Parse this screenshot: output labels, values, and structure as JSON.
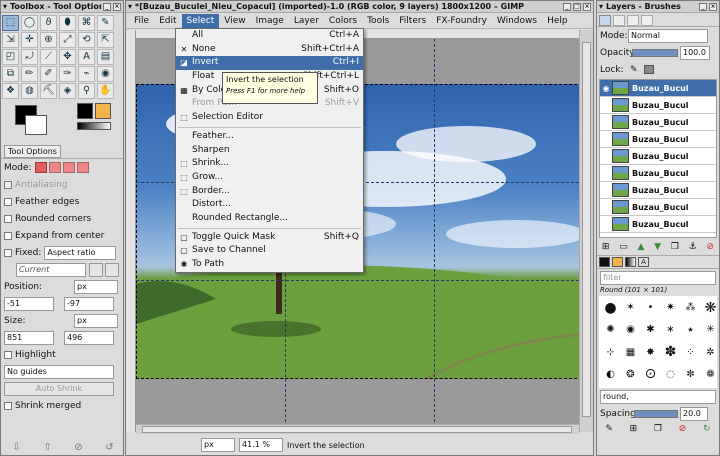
{
  "toolbox": {
    "title": "Toolbox - Tool Options",
    "tool_icons": [
      "⬚",
      "◯",
      "ϑ",
      "⬮",
      "⌘",
      "✎",
      "⇲",
      "✛",
      "⊕",
      "⤢",
      "⟲",
      "⇱",
      "◰",
      "⤾",
      "⟋",
      "✥",
      "A",
      "▤",
      "⧉",
      "✏",
      "✐",
      "✑",
      "⌁",
      "◉",
      "❖",
      "◍",
      "⛏",
      "◈",
      "⚲",
      "✋"
    ],
    "tool_options_tab": "Tool Options",
    "mode_label": "Mode:",
    "antialiasing": "Antialiasing",
    "feather_edges": "Feather edges",
    "rounded_corners": "Rounded corners",
    "expand_from_center": "Expand from center",
    "fixed_label": "Fixed:",
    "fixed_value": "Aspect ratio",
    "current": "Current",
    "position_label": "Position:",
    "position_unit": "px",
    "position_x": "-51",
    "position_y": "-97",
    "size_label": "Size:",
    "size_unit": "px",
    "size_w": "851",
    "size_h": "496",
    "highlight": "Highlight",
    "guides": "No guides",
    "auto_shrink": "Auto Shrink",
    "shrink_merged": "Shrink merged"
  },
  "image_window": {
    "title": "*[Buzau_Buculei_Nieu_Copacul] (imported)-1.0 (RGB color, 9 layers) 1800x1200 – GIMP",
    "menus": [
      "File",
      "Edit",
      "Select",
      "View",
      "Image",
      "Layer",
      "Colors",
      "Tools",
      "Filters",
      "FX-Foundry",
      "Windows",
      "Help"
    ],
    "unit": "px",
    "zoom": "41.1 %",
    "status": "Invert the selection"
  },
  "select_menu": {
    "items": [
      {
        "label": "All",
        "shortcut": "Ctrl+A",
        "icon": "",
        "state": "normal"
      },
      {
        "label": "None",
        "shortcut": "Shift+Ctrl+A",
        "icon": "✕",
        "state": "normal"
      },
      {
        "label": "Invert",
        "shortcut": "Ctrl+I",
        "icon": "◪",
        "state": "highlighted"
      },
      {
        "label": "Float",
        "shortcut": "Shift+Ctrl+L",
        "icon": "",
        "state": "normal"
      },
      {
        "label": "By Color",
        "shortcut": "Shift+O",
        "icon": "▦",
        "state": "normal"
      },
      {
        "label": "From Path",
        "shortcut": "Shift+V",
        "icon": "",
        "state": "disabled"
      },
      {
        "label": "Selection Editor",
        "shortcut": "",
        "icon": "⬚",
        "state": "normal"
      },
      {
        "sep": true
      },
      {
        "label": "Feather...",
        "shortcut": "",
        "icon": "",
        "state": "normal"
      },
      {
        "label": "Sharpen",
        "shortcut": "",
        "icon": "",
        "state": "normal"
      },
      {
        "label": "Shrink...",
        "shortcut": "",
        "icon": "⬚",
        "state": "normal"
      },
      {
        "label": "Grow...",
        "shortcut": "",
        "icon": "⬚",
        "state": "normal"
      },
      {
        "label": "Border...",
        "shortcut": "",
        "icon": "⬚",
        "state": "normal"
      },
      {
        "label": "Distort...",
        "shortcut": "",
        "icon": "",
        "state": "normal"
      },
      {
        "label": "Rounded Rectangle...",
        "shortcut": "",
        "icon": "",
        "state": "normal"
      },
      {
        "sep": true
      },
      {
        "label": "Toggle Quick Mask",
        "shortcut": "Shift+Q",
        "icon": "▢",
        "state": "normal"
      },
      {
        "label": "Save to Channel",
        "shortcut": "",
        "icon": "▢",
        "state": "normal"
      },
      {
        "label": "To Path",
        "shortcut": "",
        "icon": "✱",
        "state": "normal"
      }
    ],
    "tooltip_title": "Invert the selection",
    "tooltip_hint": "Press F1 for more help"
  },
  "layers": {
    "title": "Layers - Brushes",
    "mode_label": "Mode:",
    "mode_value": "Normal",
    "opacity_label": "Opacity:",
    "opacity_value": "100.0",
    "lock_label": "Lock:",
    "layer_name": "Buzau_Bucul",
    "layer_count": 9,
    "brush_filter": "filter",
    "brush_name": "Round (101 × 101)",
    "brush_select": "round,",
    "spacing_label": "Spacing:",
    "spacing_value": "20.0"
  },
  "colors": {
    "sky": "#4a7fc1",
    "grass": "#6f9e3e",
    "accent": "#3f6ea8",
    "tooltip": "#ffffe1"
  }
}
